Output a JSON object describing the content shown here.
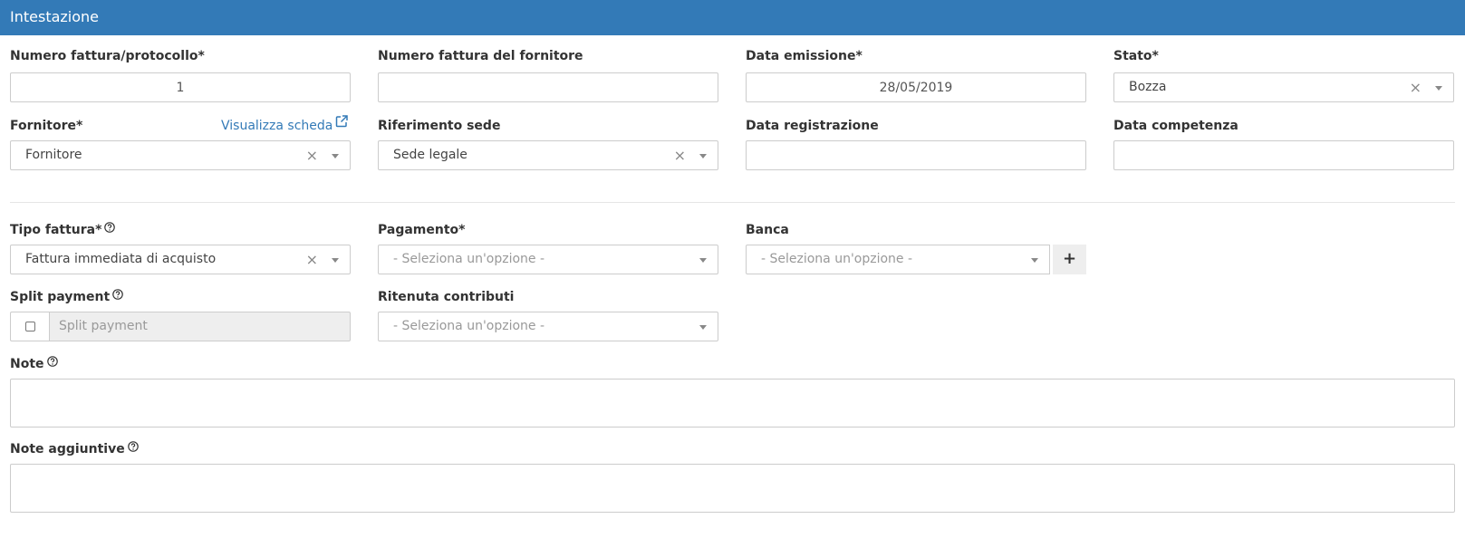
{
  "panel": {
    "title": "Intestazione"
  },
  "fields": {
    "numero_fattura": {
      "label": "Numero fattura/protocollo*",
      "value": "1"
    },
    "numero_fornitore": {
      "label": "Numero fattura del fornitore",
      "value": ""
    },
    "data_emissione": {
      "label": "Data emissione*",
      "value": "28/05/2019"
    },
    "stato": {
      "label": "Stato*",
      "value": "Bozza"
    },
    "fornitore": {
      "label": "Fornitore*",
      "value": "Fornitore",
      "link": "Visualizza scheda"
    },
    "riferimento_sede": {
      "label": "Riferimento sede",
      "value": "Sede legale"
    },
    "data_registrazione": {
      "label": "Data registrazione",
      "value": ""
    },
    "data_competenza": {
      "label": "Data competenza",
      "value": ""
    },
    "tipo_fattura": {
      "label": "Tipo fattura*",
      "value": "Fattura immediata di acquisto"
    },
    "pagamento": {
      "label": "Pagamento*",
      "placeholder": "- Seleziona un'opzione -"
    },
    "banca": {
      "label": "Banca",
      "placeholder": "- Seleziona un'opzione -",
      "add": "+"
    },
    "split_payment": {
      "label": "Split payment",
      "placeholder": "Split payment"
    },
    "ritenuta_contributi": {
      "label": "Ritenuta contributi",
      "placeholder": "- Seleziona un'opzione -"
    },
    "note": {
      "label": "Note",
      "value": ""
    },
    "note_aggiuntive": {
      "label": "Note aggiuntive",
      "value": ""
    }
  },
  "icons": {
    "help": "help-circle-icon",
    "external": "external-link-icon",
    "clear": "×",
    "dropdown": "chevron-down-icon"
  },
  "colors": {
    "header_bg": "#337ab7",
    "link": "#337ab7",
    "border": "#cccccc",
    "disabled_bg": "#eeeeee"
  }
}
